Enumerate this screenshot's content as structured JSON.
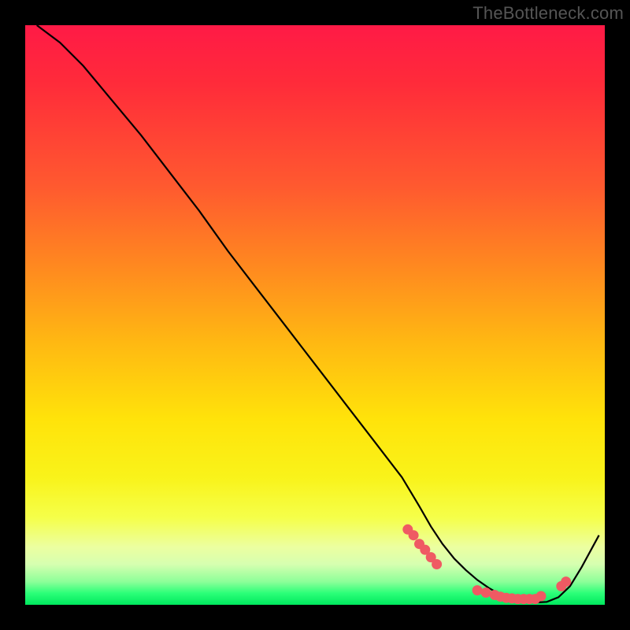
{
  "watermark": "TheBottleneck.com",
  "chart_data": {
    "type": "line",
    "title": "",
    "xlabel": "",
    "ylabel": "",
    "xlim": [
      0,
      100
    ],
    "ylim": [
      0,
      100
    ],
    "grid": false,
    "legend": false,
    "series": [
      {
        "name": "bottleneck-curve",
        "color": "#000000",
        "x": [
          2,
          6,
          10,
          15,
          20,
          25,
          30,
          35,
          40,
          45,
          50,
          55,
          60,
          65,
          68,
          70,
          72,
          74,
          76,
          78,
          80,
          82,
          84,
          86,
          88,
          90,
          92,
          94,
          96,
          99
        ],
        "values": [
          100,
          97,
          93,
          87,
          81,
          74.5,
          68,
          61,
          54.5,
          48,
          41.5,
          35,
          28.5,
          22,
          17,
          13.5,
          10.5,
          8,
          6,
          4.3,
          2.9,
          1.8,
          1.1,
          0.6,
          0.4,
          0.5,
          1.3,
          3.2,
          6.5,
          12
        ]
      }
    ],
    "markers": [
      {
        "name": "left-cluster-point",
        "x": 66,
        "y": 13
      },
      {
        "name": "left-cluster-point",
        "x": 67,
        "y": 12
      },
      {
        "name": "left-cluster-point",
        "x": 68,
        "y": 10.5
      },
      {
        "name": "left-cluster-point",
        "x": 69,
        "y": 9.5
      },
      {
        "name": "left-cluster-point",
        "x": 70,
        "y": 8.2
      },
      {
        "name": "left-cluster-point",
        "x": 71,
        "y": 7.0
      },
      {
        "name": "minimum-segment-point",
        "x": 78,
        "y": 2.5
      },
      {
        "name": "minimum-segment-point",
        "x": 79.5,
        "y": 2.1
      },
      {
        "name": "minimum-segment-point",
        "x": 81,
        "y": 1.7
      },
      {
        "name": "minimum-segment-point",
        "x": 82,
        "y": 1.4
      },
      {
        "name": "minimum-segment-point",
        "x": 83,
        "y": 1.2
      },
      {
        "name": "minimum-segment-point",
        "x": 84,
        "y": 1.1
      },
      {
        "name": "minimum-segment-point",
        "x": 85,
        "y": 1.0
      },
      {
        "name": "minimum-segment-point",
        "x": 86,
        "y": 1.0
      },
      {
        "name": "minimum-segment-point",
        "x": 87,
        "y": 1.0
      },
      {
        "name": "minimum-segment-point",
        "x": 88,
        "y": 1.0
      },
      {
        "name": "minimum-segment-point",
        "x": 89,
        "y": 1.5
      },
      {
        "name": "right-rise-point",
        "x": 92.5,
        "y": 3.2
      },
      {
        "name": "right-rise-point",
        "x": 93.3,
        "y": 4.0
      }
    ],
    "gradient_colors": {
      "top": "#ff1a46",
      "mid": "#ffe30a",
      "bottom": "#00e85e"
    }
  }
}
